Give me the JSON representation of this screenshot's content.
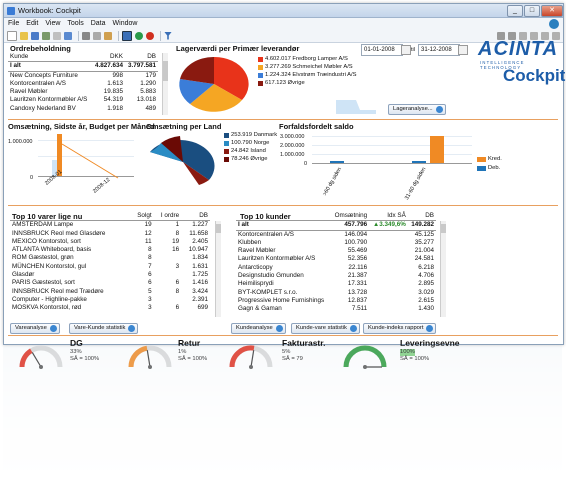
{
  "window": {
    "title": "Workbook: Cockpit",
    "minimize": "_",
    "maximize": "□",
    "close": "✕"
  },
  "menu": [
    "File",
    "Edit",
    "View",
    "Tools",
    "Data",
    "Window"
  ],
  "brand": {
    "name": "ACINTA",
    "tagline": "INTELLIGENCE TECHNOLOGY",
    "product": "Cockpit"
  },
  "orders": {
    "title": "Ordrebeholdning",
    "columns": [
      "Kunde",
      "DKK",
      "DB"
    ],
    "total": [
      "I alt",
      "4.827.634",
      "3.797.581"
    ],
    "rows": [
      [
        "New Concepts Furniture",
        "998",
        "179"
      ],
      [
        "Kontorcentralen A/S",
        "1.613",
        "1.290"
      ],
      [
        "Ravel Møbler",
        "19.835",
        "5.883"
      ],
      [
        "Lauritzen Kontormøbler A/S",
        "54.319",
        "13.018"
      ],
      [
        "Candoxy Nederland BV",
        "1.918",
        "489"
      ]
    ]
  },
  "suppliers": {
    "title": "Lagerværdi per Primær leverandør",
    "date_from": "01-01-2008",
    "date_to": "31-12-2008",
    "til": "til",
    "legend": [
      {
        "value": "4.602.017",
        "name": "Fredborg Lamper A/S",
        "color": "#e8331a"
      },
      {
        "value": "3.277.269",
        "name": "Schmeichel Møbler A/S",
        "color": "#f5a623"
      },
      {
        "value": "1.224.324",
        "name": "Elvstrøm Træindustri A/S",
        "color": "#3b7dd8"
      },
      {
        "value": "617.123",
        "name": "Øvrige",
        "color": "#8a1a10"
      }
    ],
    "button": "Lageranalyse..."
  },
  "budget": {
    "title": "Omsætning, Sidste år, Budget per Måned",
    "y_label": "1.000.000",
    "y_zero": "0",
    "x_labels": [
      "2008-01",
      "2008-12"
    ]
  },
  "countries": {
    "title": "Omsætning per Land",
    "legend": [
      {
        "value": "253.919",
        "name": "Danmark",
        "color": "#1a4e80"
      },
      {
        "value": "100.790",
        "name": "Norge",
        "color": "#2a8cc4"
      },
      {
        "value": "24.842",
        "name": "Island",
        "color": "#8a1a10"
      },
      {
        "value": "78.246",
        "name": "Øvrige",
        "color": "#6a0a05"
      }
    ]
  },
  "aging": {
    "title": "Forfaldsfordelt saldo",
    "y_labels": [
      "3.000.000",
      "2.000.000",
      "1.000.000",
      "0"
    ],
    "x_labels": [
      ">60 dg siden",
      "31-60 dg siden"
    ],
    "legend": [
      {
        "name": "Kred.",
        "color": "#f08a24"
      },
      {
        "name": "Deb.",
        "color": "#1f74b8"
      }
    ]
  },
  "top_items": {
    "title": "Top 10 varer lige nu",
    "columns": [
      "",
      "Solgt",
      "I ordre",
      "DB"
    ],
    "rows": [
      [
        "AMSTERDAM Lampe",
        "19",
        "1",
        "1.227"
      ],
      [
        "INNSBRUCK Reol med Glasdøre",
        "12",
        "8",
        "11.658"
      ],
      [
        "MEXICO Kontorstol, sort",
        "11",
        "19",
        "2.405"
      ],
      [
        "ATLANTA Whiteboard, basis",
        "8",
        "16",
        "10.947"
      ],
      [
        "ROM Gæstestol, grøn",
        "8",
        "",
        "1.834"
      ],
      [
        "MÜNCHEN Kontorstol, gul",
        "7",
        "3",
        "1.631"
      ],
      [
        "Glasdør",
        "6",
        "",
        "1.725"
      ],
      [
        "PARIS Gæstestol, sort",
        "6",
        "6",
        "1.416"
      ],
      [
        "INNSBRUCK Reol med Trædøre",
        "5",
        "8",
        "3.424"
      ],
      [
        "Computer - Highline-pakke",
        "3",
        "",
        "2.391"
      ],
      [
        "MOSKVA Kontorstol, rød",
        "3",
        "6",
        "699"
      ]
    ],
    "buttons": [
      "Vareanalyse",
      "Vare-Kunde statistik"
    ]
  },
  "top_customers": {
    "title": "Top 10 kunder",
    "columns": [
      "",
      "Omsætning",
      "Idx SÅ",
      "DB"
    ],
    "total": [
      "I alt",
      "457.796",
      "▲3.349,6%",
      "149.282"
    ],
    "rows": [
      [
        "Kontorcentralen A/S",
        "146.094",
        "",
        "45.125"
      ],
      [
        "Klubben",
        "100.790",
        "",
        "35.277"
      ],
      [
        "Ravel Møbler",
        "55.469",
        "",
        "21.004"
      ],
      [
        "Lauritzen Kontormøbler A/S",
        "52.356",
        "",
        "24.581"
      ],
      [
        "Antarcticopy",
        "22.116",
        "",
        "6.218"
      ],
      [
        "Designstudio Gmunden",
        "21.387",
        "",
        "4.706"
      ],
      [
        "Heimilisprydi",
        "17.331",
        "",
        "2.895"
      ],
      [
        "BYT-KOMPLET s.r.o.",
        "13.728",
        "",
        "3.029"
      ],
      [
        "Progressive Home Furnishings",
        "12.837",
        "",
        "2.615"
      ],
      [
        "Gagn & Gaman",
        "7.511",
        "",
        "1.430"
      ]
    ],
    "buttons": [
      "Kundeanalyse",
      "Kunde-vare statistik",
      "Kunde-indeks rapport"
    ]
  },
  "kpis": [
    {
      "label": "DG",
      "value": "33%",
      "sub": "SÅ = 100%",
      "color": "#e03020",
      "level": 0.33
    },
    {
      "label": "Retur",
      "value": "1%",
      "sub": "SÅ = 100%",
      "color": "#f08a24",
      "level": 0.45
    },
    {
      "label": "Fakturastr.",
      "value": "5%",
      "sub": "SÅ = 79",
      "color": "#e03020",
      "level": 0.55
    },
    {
      "label": "Leveringsevne",
      "value": "100%",
      "sub": "SÅ = 100%",
      "color": "#2a9a3a",
      "level": 1.0
    }
  ]
}
